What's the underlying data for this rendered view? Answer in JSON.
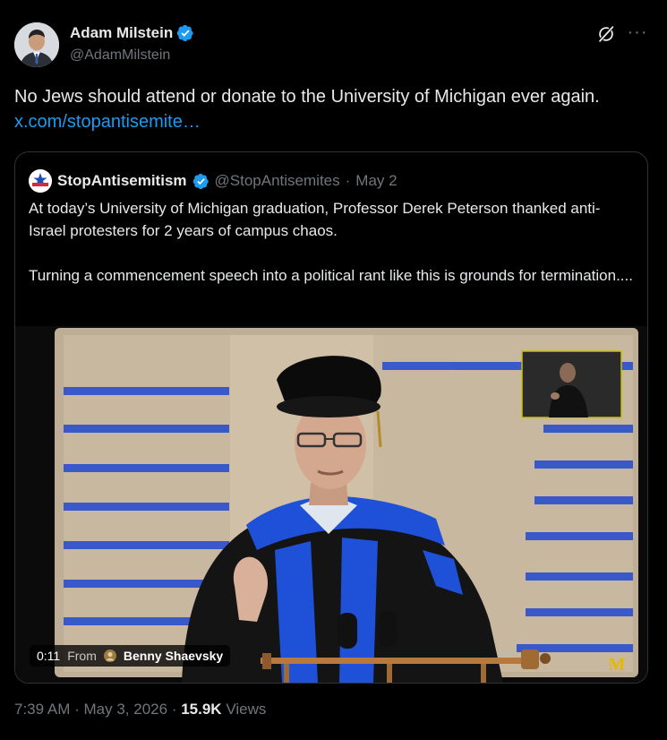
{
  "author": {
    "display_name": "Adam Milstein",
    "handle": "@AdamMilstein",
    "verified": true
  },
  "tweet": {
    "text_before_link": "No Jews should attend or donate to the University of Michigan ever again. ",
    "link_text": "x.com/stopantisemite…"
  },
  "quote": {
    "display_name": "StopAntisemitism",
    "handle": "@StopAntisemites",
    "separator": "·",
    "date": "May 2",
    "text": "At today’s University of Michigan graduation, Professor Derek Peterson thanked anti-Israel protesters for 2 years of campus chaos.\n\nTurning a commencement speech into a political rant like this is grounds for termination....",
    "avatar_caption": "STOP ANTISEMITISM",
    "video": {
      "duration": "0:11",
      "from_label": "From",
      "credit": "Benny Shaevsky",
      "watermark": "M"
    }
  },
  "meta": {
    "time": "7:39 AM",
    "sep1": "·",
    "date": "May 3, 2026",
    "sep2": "·",
    "views_count": "15.9K",
    "views_label": "Views"
  },
  "colors": {
    "background": "#000000",
    "text": "#e7e9ea",
    "secondary": "#71767b",
    "link": "#1d9bf0",
    "verified": "#1d9bf0",
    "gown_blue": "#1f50d8"
  },
  "icons": {
    "verified": "verified-badge-icon",
    "grok": "grok-icon",
    "more": "more-icon"
  }
}
